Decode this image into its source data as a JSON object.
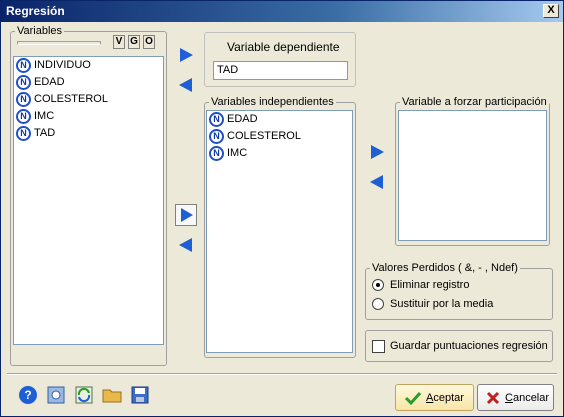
{
  "window": {
    "title": "Regresión",
    "close_glyph": "X"
  },
  "variables_panel": {
    "legend": "Variables",
    "view_buttons": [
      "V",
      "G",
      "O"
    ],
    "items": [
      {
        "icon": "N",
        "label": "INDIVIDUO"
      },
      {
        "icon": "N",
        "label": "EDAD"
      },
      {
        "icon": "N",
        "label": "COLESTEROL"
      },
      {
        "icon": "N",
        "label": "IMC"
      },
      {
        "icon": "N",
        "label": "TAD"
      }
    ]
  },
  "dependent": {
    "label": "Variable dependiente",
    "value": "TAD"
  },
  "independent": {
    "legend": "Variables independientes",
    "items": [
      {
        "icon": "N",
        "label": "EDAD"
      },
      {
        "icon": "N",
        "label": "COLESTEROL"
      },
      {
        "icon": "N",
        "label": "IMC"
      }
    ]
  },
  "forced": {
    "legend": "Variable a forzar participación",
    "items": []
  },
  "missing": {
    "legend": "Valores Perdidos ( &, - , Ndef)",
    "options": [
      {
        "label": "Eliminar registro",
        "selected": true
      },
      {
        "label": "Sustituir por la media",
        "selected": false
      }
    ]
  },
  "save_scores": {
    "label": "Guardar puntuaciones regresión",
    "checked": false
  },
  "toolbar_icons": [
    "help-icon",
    "settings-icon",
    "refresh-icon",
    "open-folder-icon",
    "save-icon"
  ],
  "buttons": {
    "ok_accel": "A",
    "ok_rest": "ceptar",
    "cancel_accel": "C",
    "cancel_rest": "ancelar"
  },
  "colors": {
    "accent_blue": "#1f5fd6",
    "title_bar": "#0a246a"
  }
}
